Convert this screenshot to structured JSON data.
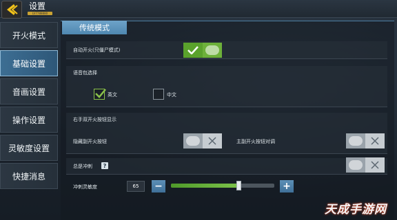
{
  "header": {
    "title": "设置",
    "level_text": "LV7788880"
  },
  "sidebar": {
    "items": [
      {
        "label": "开火模式",
        "active": false
      },
      {
        "label": "基础设置",
        "active": true
      },
      {
        "label": "音画设置",
        "active": false
      },
      {
        "label": "操作设置",
        "active": false
      },
      {
        "label": "灵敏度设置",
        "active": false
      },
      {
        "label": "快捷消息",
        "active": false
      }
    ]
  },
  "main": {
    "mode_tab": "传统模式",
    "auto_fire": {
      "label": "自动开火(只僵尸模式)",
      "on": true
    },
    "voice_pack": {
      "label": "语音包选择",
      "options": [
        {
          "label": "英文",
          "checked": true
        },
        {
          "label": "中文",
          "checked": false
        }
      ]
    },
    "right_fire_section": "右手双开火按钮显示",
    "hide_secondary": {
      "label": "隐藏副开火按钮",
      "on": false
    },
    "swap_fire": {
      "label": "主副开火按钮对调",
      "on": false
    },
    "always_sprint": {
      "label": "总是冲刺",
      "on": false,
      "help": "?"
    },
    "sprint_sensitivity": {
      "label": "冲刺灵敏度",
      "value": "65",
      "min": 0,
      "max": 100,
      "minus": "−",
      "plus": "+"
    }
  },
  "watermark": "天成手游网",
  "colors": {
    "accent": "#4f87b0",
    "on_green": "#5aa22c",
    "sidebar_active": "#3d6e93"
  }
}
